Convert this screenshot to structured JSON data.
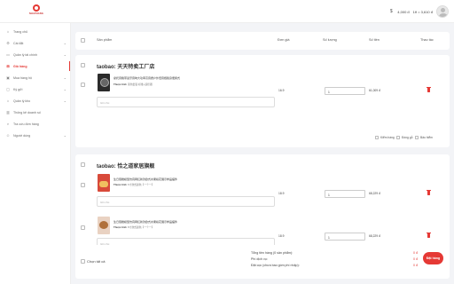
{
  "brand": {
    "logo_text": "NHAPHANG",
    "accent": "#e53935"
  },
  "topbar": {
    "currency_icon": "money-icon",
    "balance": "4,000 đ",
    "rate": "1¥ = 3,610 đ"
  },
  "sidebar": {
    "items": [
      {
        "label": "Trang chủ",
        "icon": "home-icon",
        "chevron": false,
        "active": false
      },
      {
        "label": "Cài đặt",
        "icon": "gear-icon",
        "chevron": true,
        "active": false
      },
      {
        "label": "Quản lý tài chính",
        "icon": "wallet-icon",
        "chevron": true,
        "active": false
      },
      {
        "label": "Giỏ hàng",
        "icon": "cart-icon",
        "chevron": false,
        "active": true
      },
      {
        "label": "Mua hàng hộ",
        "icon": "bag-icon",
        "chevron": true,
        "active": false
      },
      {
        "label": "Ký gửi",
        "icon": "box-icon",
        "chevron": true,
        "active": false
      },
      {
        "label": "Quản lý kho",
        "icon": "warehouse-icon",
        "chevron": true,
        "active": false
      },
      {
        "label": "Thống kê doanh số",
        "icon": "chart-icon",
        "chevron": false,
        "active": false
      },
      {
        "label": "Tra cứu đơn hàng",
        "icon": "search-icon",
        "chevron": false,
        "active": false
      },
      {
        "label": "Người dùng",
        "icon": "user-icon",
        "chevron": true,
        "active": false
      }
    ]
  },
  "table": {
    "headers": {
      "product": "Sản phẩm",
      "unit_price": "Đơn giá",
      "quantity": "Số lượng",
      "amount": "Số tiền",
      "action": "Thao tác"
    }
  },
  "shops": [
    {
      "name": "taobao: 天天特卖工厂店",
      "items": [
        {
          "image": "speaker-image",
          "title": "摩托音箱带蓝牙音响大功率高音质户外低音炮随身便携式",
          "variant_label": "Thuộc tính:",
          "variant": "黑色套装-标准+遥控器",
          "note_placeholder": "Ghi chú",
          "price": "16.9",
          "qty": "1",
          "amount": "61,009 đ"
        }
      ],
      "options": [
        "Kiểm hàng",
        "Đóng gỗ",
        "Bảo hiểm"
      ]
    },
    {
      "name": "taobao: 恰之道家居旗舰",
      "items": [
        {
          "image": "cake-image-1",
          "title": "生日蛋糕模型仿真网红新款欧式水果裱花展示样品摆件",
          "variant_label": "Thuộc tính:",
          "variant": "6寸款式颜色【一个一】",
          "note_placeholder": "Ghi chú",
          "price": "18.9",
          "qty": "1",
          "amount": "68,229 đ"
        },
        {
          "image": "cake-image-2",
          "title": "生日蛋糕模型仿真网红新款欧式水果裱花展示样品摆件",
          "variant_label": "Thuộc tính:",
          "variant": "8寸款式颜色【一个一】",
          "note_placeholder": "Ghi chú",
          "price": "18.9",
          "qty": "1",
          "amount": "68,229 đ"
        }
      ],
      "options": [
        "Kiểm hàng",
        "Đóng gỗ",
        "Bảo hiểm"
      ]
    }
  ],
  "footer": {
    "select_all": "Chọn tất cả",
    "total_label": "Tổng tiền hàng (0 sản phẩm):",
    "total_value": "0 đ",
    "fee_label": "Phí dịch vụ:",
    "fee_value": "0 đ",
    "deposit_label": "Đặt cọc (chưa bao gồm phí nhập):",
    "deposit_value": "0 đ",
    "order_button": "Đặt hàng"
  }
}
